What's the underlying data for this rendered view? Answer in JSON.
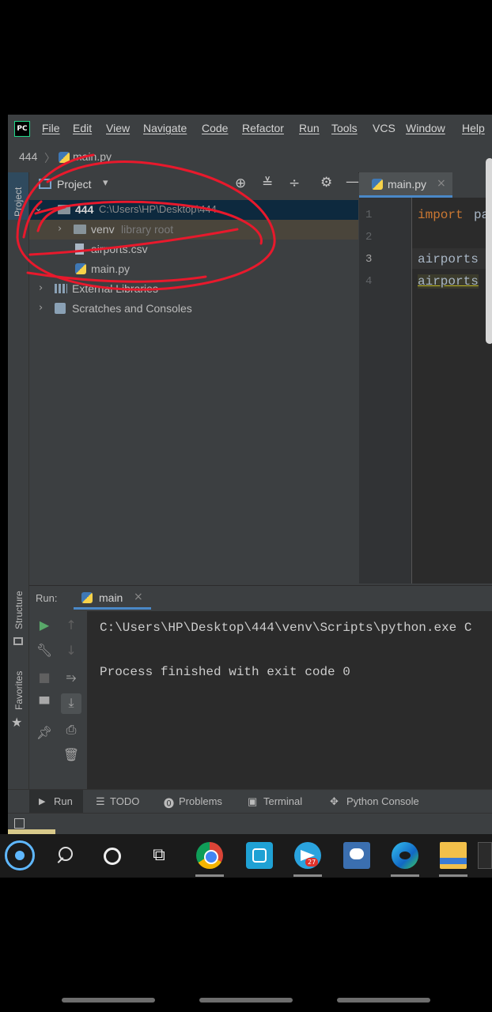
{
  "menu": {
    "logo": "PC",
    "items": [
      "File",
      "Edit",
      "View",
      "Navigate",
      "Code",
      "Refactor",
      "Run",
      "Tools",
      "VCS",
      "Window",
      "Help"
    ]
  },
  "breadcrumb": {
    "project": "444",
    "sep": "〉",
    "file": "main.py"
  },
  "left_stripe": {
    "project_label": "Project",
    "structure_label": "Structure",
    "favorites_label": "Favorites"
  },
  "project_panel": {
    "title": "Project",
    "dropdown": "▾",
    "tree": {
      "root_name": "444",
      "root_path": "C:\\Users\\HP\\Desktop\\444",
      "venv_name": "venv",
      "venv_tag": "library root",
      "csv": "airports.csv",
      "main": "main.py",
      "ext_libs": "External Libraries",
      "scratches": "Scratches and Consoles"
    }
  },
  "editor": {
    "tab": "main.py",
    "tab_close": "×",
    "line_numbers": [
      "1",
      "2",
      "3",
      "4"
    ],
    "line1_kw": "import",
    "line1_rest": " pa",
    "line3": "airports",
    "line4": "airports"
  },
  "run": {
    "label": "Run:",
    "tab": "main",
    "tab_close": "×",
    "console": {
      "line1": "C:\\Users\\HP\\Desktop\\444\\venv\\Scripts\\python.exe C",
      "line2": "Process finished with exit code 0"
    }
  },
  "bottom_tools": [
    "Run",
    "TODO",
    "Problems",
    "Terminal",
    "Python Console"
  ],
  "taskbar": {
    "telegram_badge": "27"
  },
  "colors": {
    "ide_bg": "#3c3f41",
    "editor_bg": "#2b2b2b",
    "keyword": "#cc7832",
    "annotation": "#e8192c",
    "selection": "#0d293e"
  }
}
